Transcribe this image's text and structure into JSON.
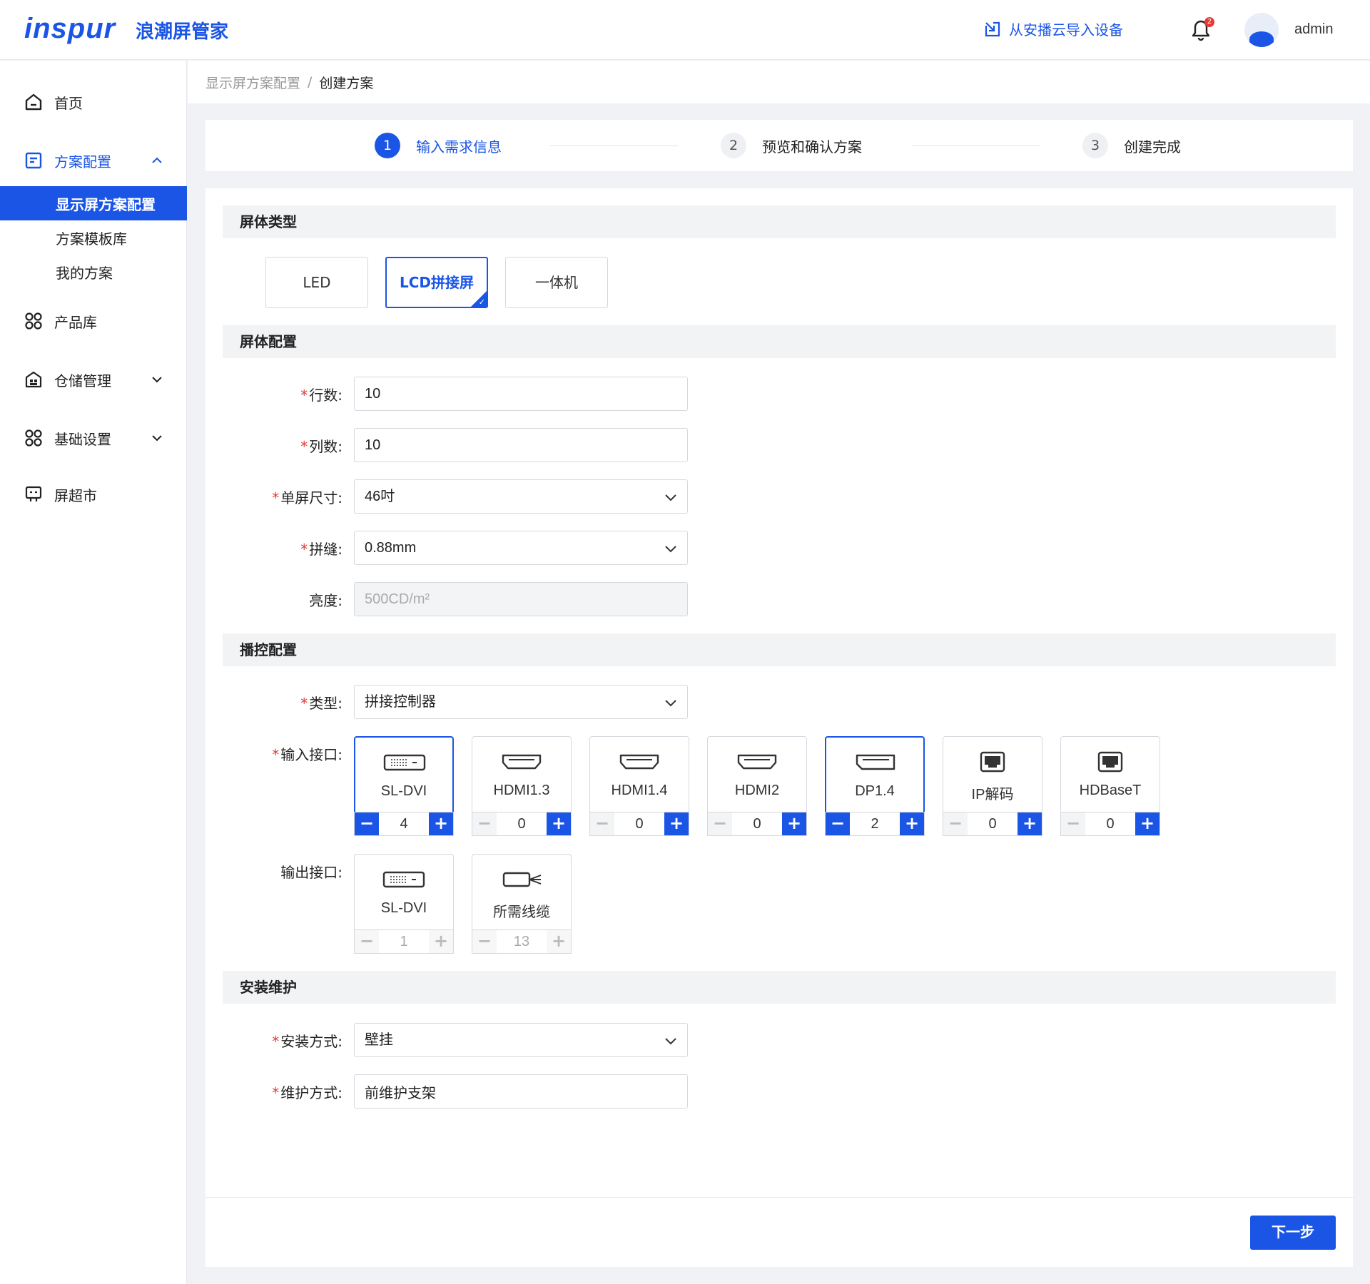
{
  "header": {
    "logo": "inspur",
    "brand": "浪潮屏管家",
    "import_label": "从安播云导入设备",
    "notification_count": "2",
    "username": "admin"
  },
  "sidebar": {
    "home": "首页",
    "scheme_config": "方案配置",
    "sub_items": [
      "显示屏方案配置",
      "方案模板库",
      "我的方案"
    ],
    "product_lib": "产品库",
    "warehouse": "仓储管理",
    "basic_settings": "基础设置",
    "screen_market": "屏超市"
  },
  "breadcrumb": {
    "parent": "显示屏方案配置",
    "separator": "/",
    "current": "创建方案"
  },
  "steps": [
    {
      "num": "1",
      "label": "输入需求信息"
    },
    {
      "num": "2",
      "label": "预览和确认方案"
    },
    {
      "num": "3",
      "label": "创建完成"
    }
  ],
  "sections": {
    "screen_type": "屏体类型",
    "screen_config": "屏体配置",
    "control_config": "播控配置",
    "install": "安装维护"
  },
  "screen_types": [
    "LED",
    "LCD拼接屏",
    "一体机"
  ],
  "selected_screen_type": "LCD拼接屏",
  "required_mark": "*",
  "fields": {
    "rows": {
      "label": "行数:",
      "value": "10"
    },
    "cols": {
      "label": "列数:",
      "value": "10"
    },
    "size": {
      "label": "单屏尺寸:",
      "value": "46吋"
    },
    "seam": {
      "label": "拼缝:",
      "value": "0.88mm"
    },
    "brightness": {
      "label": "亮度:",
      "value": "500CD/m²"
    },
    "ctrl_type": {
      "label": "类型:",
      "value": "拼接控制器"
    },
    "input_ports_label": "输入接口:",
    "output_ports_label": "输出接口:",
    "install_method": {
      "label": "安装方式:",
      "value": "壁挂"
    },
    "maintain_method": {
      "label": "维护方式:",
      "value": "前维护支架"
    }
  },
  "input_ports": [
    {
      "name": "SL-DVI",
      "value": "4",
      "icon": "dvi-icon"
    },
    {
      "name": "HDMI1.3",
      "value": "0",
      "icon": "hdmi-icon"
    },
    {
      "name": "HDMI1.4",
      "value": "0",
      "icon": "hdmi-icon"
    },
    {
      "name": "HDMI2",
      "value": "0",
      "icon": "hdmi-icon"
    },
    {
      "name": "DP1.4",
      "value": "2",
      "icon": "displayport-icon"
    },
    {
      "name": "IP解码",
      "value": "0",
      "icon": "ethernet-icon"
    },
    {
      "name": "HDBaseT",
      "value": "0",
      "icon": "ethernet-icon"
    }
  ],
  "output_ports": [
    {
      "name": "SL-DVI",
      "value": "1",
      "icon": "dvi-icon"
    },
    {
      "name": "所需线缆",
      "value": "13",
      "icon": "cable-icon"
    }
  ],
  "stepper_symbols": {
    "minus": "−",
    "plus": "+"
  },
  "next_button": "下一步",
  "colors": {
    "accent": "#1a55e6",
    "required": "#e53935"
  }
}
